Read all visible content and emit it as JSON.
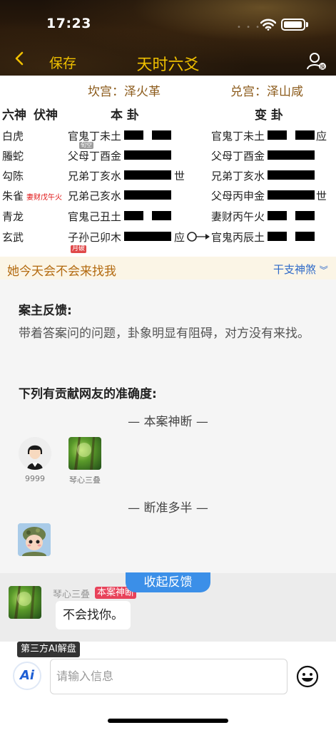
{
  "status_bar": {
    "time": "17:23"
  },
  "nav": {
    "back_icon": "chevron-left",
    "save_label": "保存",
    "title": "天时六爻",
    "user_icon": "user-icon"
  },
  "palaces": {
    "base": "坎宫：泽火革",
    "changed": "兑宫：泽山咸"
  },
  "table_headers": {
    "six_gods": "六神",
    "hidden": "伏神",
    "base": "本 卦",
    "changed": "变 卦"
  },
  "rows": [
    {
      "god": "白虎",
      "hidden": "",
      "base": "官鬼丁未土",
      "base_line": "yin",
      "base_mark": "",
      "base_tag": "",
      "changed": "官鬼丁未土",
      "changed_line": "yin",
      "changed_mark": "应"
    },
    {
      "god": "螣蛇",
      "hidden": "",
      "base": "父母丁酉金",
      "base_line": "yang",
      "base_mark": "",
      "base_tag": "旬空",
      "changed": "父母丁酉金",
      "changed_line": "yang",
      "changed_mark": ""
    },
    {
      "god": "勾陈",
      "hidden": "",
      "base": "兄弟丁亥水",
      "base_line": "yang",
      "base_mark": "世",
      "base_tag": "",
      "changed": "兄弟丁亥水",
      "changed_line": "yang",
      "changed_mark": ""
    },
    {
      "god": "朱雀",
      "hidden": "妻财戊午火",
      "base": "兄弟己亥水",
      "base_line": "yang",
      "base_mark": "",
      "base_tag": "",
      "changed": "父母丙申金",
      "changed_line": "yang",
      "changed_mark": "世"
    },
    {
      "god": "青龙",
      "hidden": "",
      "base": "官鬼己丑土",
      "base_line": "yin",
      "base_mark": "",
      "base_tag": "",
      "changed": "妻财丙午火",
      "changed_line": "yin",
      "changed_mark": ""
    },
    {
      "god": "玄武",
      "hidden": "",
      "base": "子孙己卯木",
      "base_line": "yang",
      "base_mark": "应",
      "base_tag": "月破",
      "changed": "官鬼丙辰土",
      "changed_line": "yin",
      "changed_mark": ""
    }
  ],
  "question": {
    "text": "她今天会不会来找我",
    "link": "干支神煞"
  },
  "feedback": {
    "title": "案主反馈:",
    "body": "带着答案问的问题，卦象明显有阻碍，对方没有来找。",
    "accuracy_title": "下列有贡献网友的准确度:",
    "section1": "— 本案神断 —",
    "section2": "— 断准多半 —",
    "users1": [
      {
        "name": "9999",
        "avatar": "monk-avatar"
      },
      {
        "name": "琴心三叠",
        "avatar": "forest-avatar"
      }
    ],
    "users2": [
      {
        "name": "",
        "avatar": "soldier-avatar"
      }
    ]
  },
  "collapse_label": "收起反馈",
  "comment": {
    "name": "琴心三叠",
    "badge": "本案神断",
    "text": "不会找你。"
  },
  "bottom": {
    "ai_tip": "第三方AI解盘",
    "ai_label": "Ai",
    "placeholder": "请输入信息"
  }
}
